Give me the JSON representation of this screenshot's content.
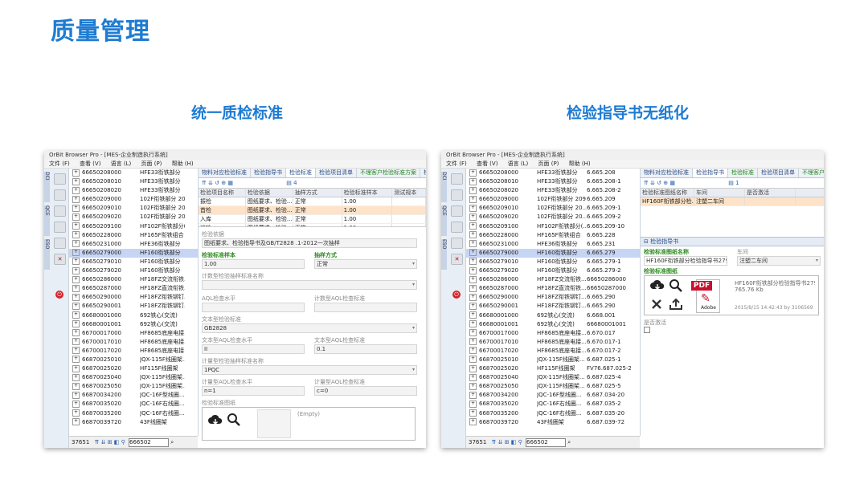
{
  "page_title": "质量管理",
  "left_caption": "统一质检标准",
  "right_caption": "检验指导书无纸化",
  "window": {
    "title": "OrBit Browser Pro - [MES-企业制造执行系统]",
    "menu": [
      "文件 (F)",
      "查看 (V)",
      "语言 (L)",
      "页面 (P)",
      "帮助 (H)"
    ],
    "side_tabs": [
      "DCI",
      "QCE",
      "ESO"
    ]
  },
  "tree_left": [
    {
      "code": "66650208000",
      "name": "HFE33衔铁部分",
      "sel": false
    },
    {
      "code": "66650208010",
      "name": "HFE33衔铁部分",
      "sel": false
    },
    {
      "code": "66650208020",
      "name": "HFE33衔铁部分",
      "sel": false
    },
    {
      "code": "66650209000",
      "name": "102F衔铁部分 209",
      "sel": false
    },
    {
      "code": "66650209010",
      "name": "102F衔铁部分 20...",
      "sel": false
    },
    {
      "code": "66650209020",
      "name": "102F衔铁部分 20...",
      "sel": false
    },
    {
      "code": "66650209100",
      "name": "HF102F衔铁部分(...",
      "sel": false
    },
    {
      "code": "66650228000",
      "name": "HF165F衔铁组合",
      "sel": false
    },
    {
      "code": "66650231000",
      "name": "HFE36衔铁部分",
      "sel": false
    },
    {
      "code": "66650279000",
      "name": "HF160衔铁部分",
      "sel": true
    },
    {
      "code": "66650279010",
      "name": "HF160衔铁部分",
      "sel": false
    },
    {
      "code": "66650279020",
      "name": "HF160衔铁部分",
      "sel": false
    },
    {
      "code": "66650286000",
      "name": "HF18FZ交流衔铁...",
      "sel": false
    },
    {
      "code": "66650287000",
      "name": "HF18FZ直流衔铁...",
      "sel": false
    },
    {
      "code": "66650290000",
      "name": "HF18FZ衔铁铆钉...",
      "sel": false
    },
    {
      "code": "66650290001",
      "name": "HF18FZ衔铁铆钉...",
      "sel": false
    },
    {
      "code": "66680001000",
      "name": "692铁心(交流)",
      "sel": false
    },
    {
      "code": "66680001001",
      "name": "692铁心(交流)",
      "sel": false
    },
    {
      "code": "66700017000",
      "name": "HF8685底座电接...",
      "sel": false
    },
    {
      "code": "66700017010",
      "name": "HF8685底座电接...",
      "sel": false
    },
    {
      "code": "66700017020",
      "name": "HF8685底座电接...",
      "sel": false
    },
    {
      "code": "66870025010",
      "name": "JQX-115F线圈架...",
      "sel": false
    },
    {
      "code": "66870025020",
      "name": "HF115F线圈架",
      "sel": false
    },
    {
      "code": "66870025040",
      "name": "JQX-115F线圈架...",
      "sel": false
    },
    {
      "code": "66870025050",
      "name": "JQX-115F线圈架...",
      "sel": false
    },
    {
      "code": "66870034200",
      "name": "JQC-16F型线圈...",
      "sel": false
    },
    {
      "code": "66870035020",
      "name": "JQC-16F右线圈...",
      "sel": false
    },
    {
      "code": "66870035200",
      "name": "JQC-16F右线圈...",
      "sel": false
    },
    {
      "code": "66870039720",
      "name": "43F线圈架",
      "sel": false
    }
  ],
  "tree_right": [
    {
      "code": "66650208000",
      "name": "HFE33衔铁部分",
      "drw": "6.665.208",
      "sel": false
    },
    {
      "code": "66650208010",
      "name": "HFE33衔铁部分",
      "drw": "6.665.208-1",
      "sel": false
    },
    {
      "code": "66650208020",
      "name": "HFE33衔铁部分",
      "drw": "6.665.208-2",
      "sel": false
    },
    {
      "code": "66650209000",
      "name": "102F衔铁部分 209",
      "drw": "6.665.209",
      "sel": false
    },
    {
      "code": "66650209010",
      "name": "102F衔铁部分 20...",
      "drw": "6.665.209-1",
      "sel": false
    },
    {
      "code": "66650209020",
      "name": "102F衔铁部分 20...",
      "drw": "6.665.209-2",
      "sel": false
    },
    {
      "code": "66650209100",
      "name": "HF102F衔铁部分(...",
      "drw": "6.665.209-10",
      "sel": false
    },
    {
      "code": "66650228000",
      "name": "HF165F衔铁组合",
      "drw": "6.665.228",
      "sel": false
    },
    {
      "code": "66650231000",
      "name": "HFE36衔铁部分",
      "drw": "6.665.231",
      "sel": false
    },
    {
      "code": "66650279000",
      "name": "HF160衔铁部分",
      "drw": "6.665.279",
      "sel": true
    },
    {
      "code": "66650279010",
      "name": "HF160衔铁部分",
      "drw": "6.665.279-1",
      "sel": false
    },
    {
      "code": "66650279020",
      "name": "HF160衔铁部分",
      "drw": "6.665.279-2",
      "sel": false
    },
    {
      "code": "66650286000",
      "name": "HF18FZ交流衔铁...",
      "drw": "66650286000",
      "sel": false
    },
    {
      "code": "66650287000",
      "name": "HF18FZ直流衔铁...",
      "drw": "66650287000",
      "sel": false
    },
    {
      "code": "66650290000",
      "name": "HF18FZ衔铁铆钉...",
      "drw": "6.665.290",
      "sel": false
    },
    {
      "code": "66650290001",
      "name": "HF18FZ衔铁铆钉...",
      "drw": "6.665.290",
      "sel": false
    },
    {
      "code": "66680001000",
      "name": "692铁心(交流)",
      "drw": "6.668.001",
      "sel": false
    },
    {
      "code": "66680001001",
      "name": "692铁心(交流)",
      "drw": "66680001001",
      "sel": false
    },
    {
      "code": "66700017000",
      "name": "HF8685底座电接...",
      "drw": "6.670.017",
      "sel": false
    },
    {
      "code": "66700017010",
      "name": "HF8685底座电接...",
      "drw": "6.670.017-1",
      "sel": false
    },
    {
      "code": "66700017020",
      "name": "HF8685底座电接...",
      "drw": "6.670.017-2",
      "sel": false
    },
    {
      "code": "66870025010",
      "name": "JQX-115F线圈架...",
      "drw": "6.687.025-1",
      "sel": false
    },
    {
      "code": "66870025020",
      "name": "HF115F线圈架",
      "drw": "FV76.687.025-2",
      "sel": false
    },
    {
      "code": "66870025040",
      "name": "JQX-115F线圈架...",
      "drw": "6.687.025-4",
      "sel": false
    },
    {
      "code": "66870025050",
      "name": "JQX-115F线圈架...",
      "drw": "6.687.025-5",
      "sel": false
    },
    {
      "code": "66870034200",
      "name": "JQC-16F型线圈...",
      "drw": "6.687.034-20",
      "sel": false
    },
    {
      "code": "66870035020",
      "name": "JQC-16F右线圈...",
      "drw": "6.687.035-2",
      "sel": false
    },
    {
      "code": "66870035200",
      "name": "JQC-16F右线圈...",
      "drw": "6.687.035-20",
      "sel": false
    },
    {
      "code": "66870039720",
      "name": "43F线圈架",
      "drw": "6.687.039-72",
      "sel": false
    }
  ],
  "status": {
    "count": "37651",
    "search": "666502"
  },
  "left_panel": {
    "tabs": [
      "物料对应检验标准",
      "检验指导书",
      "检验标准",
      "检验项目清单",
      "不理客户检验标准方案",
      "检验"
    ],
    "active_tab": 2,
    "page": "4",
    "grid_headers": [
      "检验项目名称",
      "检验依据",
      "抽样方式",
      "检验标准样本",
      "测试规本"
    ],
    "grid_rows": [
      [
        "振检",
        "图纸要求、检验...",
        "正常",
        "1.00",
        ""
      ],
      [
        "首检",
        "图纸要求、检验...",
        "正常",
        "1.00",
        ""
      ],
      [
        "入库",
        "图纸要求、检验...",
        "正常",
        "1.00",
        ""
      ],
      [
        "巡检",
        "图纸要求、检验...",
        "正常",
        "1.00",
        ""
      ]
    ],
    "form": {
      "basis_label": "检验依据",
      "basis_value": "图纸要求、检验指导书及GB/T2828 .1-2012一次抽样",
      "sample_label": "检验标准样本",
      "sample_value": "1.00",
      "mode_label": "抽样方式",
      "mode_value": "正常",
      "count_label": "计数型检验抽样标准名称",
      "aql_label": "AQL检查水平",
      "aql_std_label": "计数型AQL检查标准",
      "text_label": "文本型检验标准",
      "text_value": "GB2828",
      "text_aql_label": "文本型AQL检查水平",
      "text_aql_value": "II",
      "text_aql_std_label": "文本型AQL检查标准",
      "text_aql_std_value": "0.1",
      "measure_label": "计量型检验抽样标准名称",
      "measure_value": "1PQC",
      "measure_aql_label": "计量型AQL检查水平",
      "measure_aql_value": "n=1",
      "measure_aql_std_label": "计量型AQL检查标准",
      "measure_aql_std_value": "c=0",
      "drawing_label": "检验标准图纸",
      "empty_label": "(Empty)"
    }
  },
  "right_panel": {
    "tabs": [
      "物料对应检验标准",
      "检验指导书",
      "检验标准",
      "检验项目清单",
      "不理客户检验"
    ],
    "active_tab": 1,
    "page": "1",
    "grid_headers": [
      "检验标准图纸名称",
      "车间",
      "是否激活"
    ],
    "grid_row": [
      "HF160F衔铁部分检...",
      "注塑二车间",
      ""
    ],
    "section_title": "检验指导书",
    "doc_name_label": "检验标准图纸名称",
    "doc_name_value": "HF160F衔铁部分检验指导书279-X",
    "workshop_label": "车间",
    "workshop_value": "注塑二车间",
    "drawing_label": "检验标准图纸",
    "file_name": "HF160F衔铁部分检验指导书279-X",
    "file_size": "765.76 Kb",
    "file_meta": "2015/8/15 14:42:43 by 3106569",
    "pdf_label": "PDF",
    "adobe_label": "Adobe",
    "active_label": "是否激活"
  },
  "colors": {
    "accent": "#1e7bd2",
    "selection": "#c7d5f5",
    "grid_sel": "#ffe3c8",
    "green_label": "#2e8b20"
  }
}
